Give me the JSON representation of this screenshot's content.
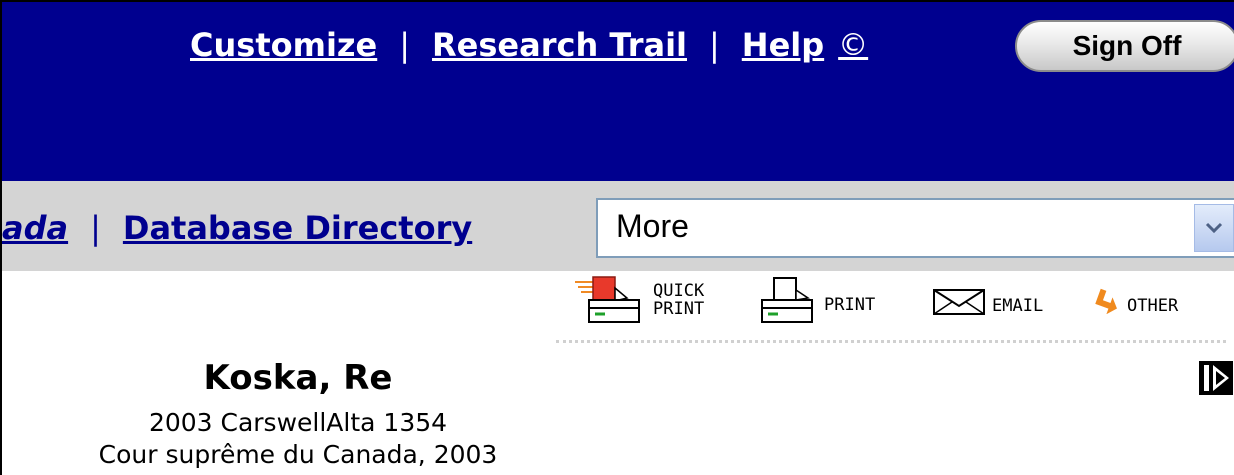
{
  "header": {
    "links": [
      "Customize",
      "Research Trail",
      "Help"
    ],
    "copyright_symbol": "©",
    "separator": "|",
    "sign_off_label": "Sign Off",
    "background_color": "#00008f"
  },
  "nav": {
    "partial_link": "ada",
    "separator": "|",
    "database_directory_label": "Database Directory",
    "background_color": "#d4d4d4",
    "select": {
      "selected": "More"
    }
  },
  "toolbar": {
    "quick_print": [
      "QUICK",
      "PRINT"
    ],
    "print": "PRINT",
    "email": "EMAIL",
    "other": "OTHER"
  },
  "document": {
    "title": "Koska, Re",
    "citation": "2003 CarswellAlta 1354",
    "court": "Cour suprême du Canada, 2003"
  }
}
